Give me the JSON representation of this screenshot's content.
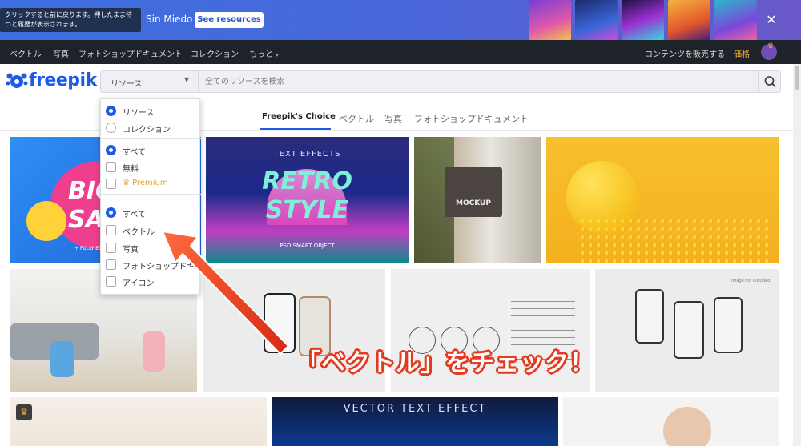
{
  "banner": {
    "tooltip": "クリックすると前に戻ります。押したまま待つと履歴が表示されます。",
    "text": "Sin Miedo",
    "button_label": "See resources",
    "close_icon": "close-icon"
  },
  "nav": {
    "items": [
      "ベクトル",
      "写真",
      "フォトショップドキュメント",
      "コレクション",
      "もっと"
    ],
    "sell": "コンテンツを販売する",
    "price": "価格"
  },
  "logo": {
    "text": "freepik"
  },
  "search": {
    "select_label": "リソース",
    "placeholder": "全てのリソースを検索"
  },
  "tabs": [
    "Freepik's Choice",
    "ベクトル",
    "写真",
    "フォトショップドキュメント"
  ],
  "dropdown": {
    "group1": [
      {
        "label": "リソース",
        "checked": true
      },
      {
        "label": "コレクション",
        "checked": false
      }
    ],
    "group2": [
      {
        "label": "すべて",
        "checked": true
      },
      {
        "label": "無料",
        "checked": false
      },
      {
        "label": "Premium",
        "checked": false
      }
    ],
    "group3": [
      {
        "label": "すべて",
        "checked": true
      },
      {
        "label": "ベクトル",
        "checked": false
      },
      {
        "label": "写真",
        "checked": false
      },
      {
        "label": "フォトショップドキュメント",
        "checked": false
      },
      {
        "label": "アイコン",
        "checked": false
      }
    ]
  },
  "gallery": {
    "tile1": {
      "line1": "BIG",
      "line2": "SA",
      "caption": "+ FULLY EDITABLE"
    },
    "tile2": {
      "header": "TEXT EFFECTS",
      "line1": "RETRO",
      "line2": "STYLE",
      "caption": "PSD SMART OBJECT"
    },
    "tile3": {
      "sign": "MOCKUP"
    },
    "tile7": {
      "note": "Image not included"
    },
    "tile10": {
      "header": "VECTOR TEXT EFFECT"
    }
  },
  "annotation": {
    "callout": "「ベクトル」をチェック！"
  },
  "colors": {
    "accent": "#1d5ae6",
    "annotation_red": "#e33a20",
    "nav_bg": "#1d2328",
    "premium": "#e2a83b"
  }
}
